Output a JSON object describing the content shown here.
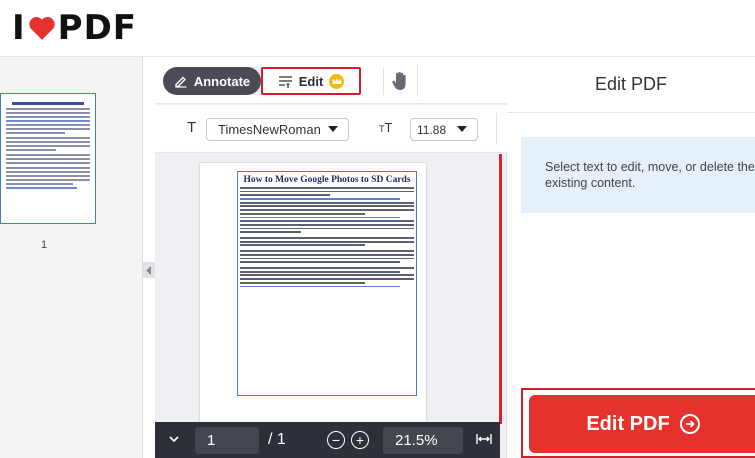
{
  "app": {
    "logo": {
      "before": "I",
      "after": "PDF",
      "heart_color": "#e5322d"
    }
  },
  "thumbnails": {
    "pages": [
      {
        "number": "1"
      }
    ]
  },
  "toolbar": {
    "annotate_label": "Annotate",
    "edit_label": "Edit",
    "hand_tool": "hand-icon"
  },
  "format": {
    "font_icon": "T",
    "font_family": "TimesNewRoman",
    "size_icon_small": "T",
    "size_icon_large": "T",
    "font_size": "11.88"
  },
  "document": {
    "title": "How to Move Google Photos to SD Cards"
  },
  "footer": {
    "page_current": "1",
    "page_total": "/ 1",
    "zoom": "21.5%"
  },
  "right_panel": {
    "title": "Edit PDF",
    "info": "Select text to edit, move, or delete the existing content.",
    "cta_label": "Edit PDF"
  },
  "colors": {
    "brand_red": "#e5322d",
    "highlight_red": "#d1202a",
    "dark_bar": "#2e3038",
    "info_bg": "#e6f0fb",
    "premium_gold": "#f5b90f"
  }
}
